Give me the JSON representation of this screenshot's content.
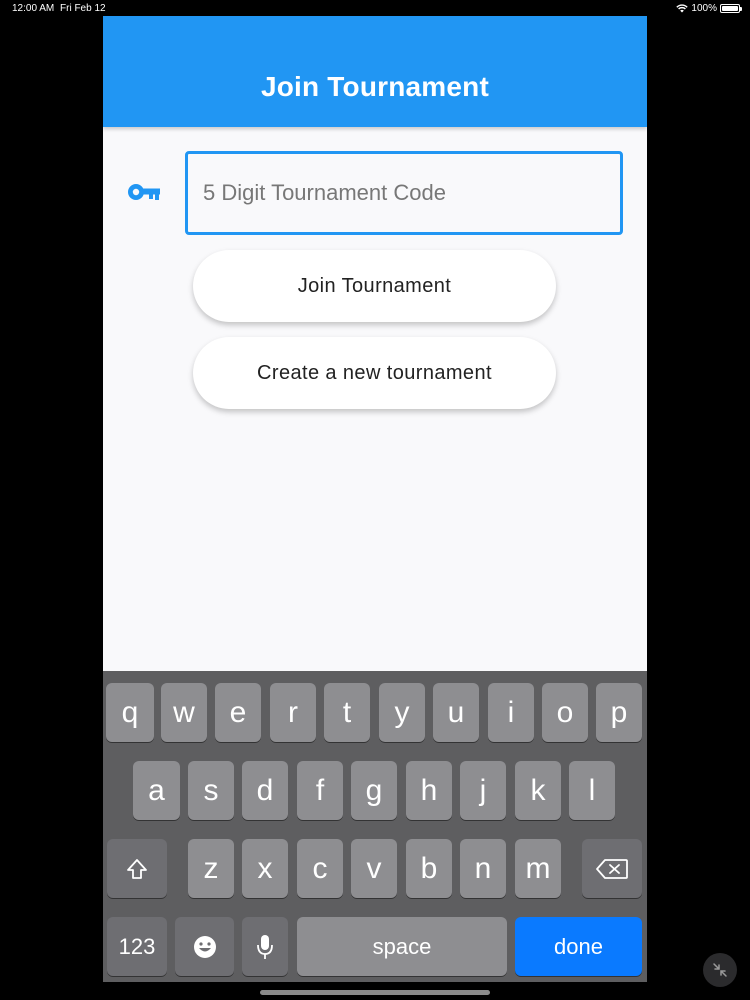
{
  "status_bar": {
    "time": "12:00 AM",
    "date": "Fri Feb 12",
    "battery": "100%"
  },
  "app_bar": {
    "title": "Join Tournament",
    "color": "#2196f3"
  },
  "code_input": {
    "icon": "key-icon",
    "placeholder": "5 Digit Tournament Code",
    "value": ""
  },
  "buttons": {
    "join": "Join Tournament",
    "create": "Create a new tournament"
  },
  "keyboard": {
    "row1": [
      "q",
      "w",
      "e",
      "r",
      "t",
      "y",
      "u",
      "i",
      "o",
      "p"
    ],
    "row2": [
      "a",
      "s",
      "d",
      "f",
      "g",
      "h",
      "j",
      "k",
      "l"
    ],
    "row3": [
      "z",
      "x",
      "c",
      "v",
      "b",
      "n",
      "m"
    ],
    "numbers_label": "123",
    "space_label": "space",
    "done_label": "done",
    "done_color": "#0a7aff"
  }
}
